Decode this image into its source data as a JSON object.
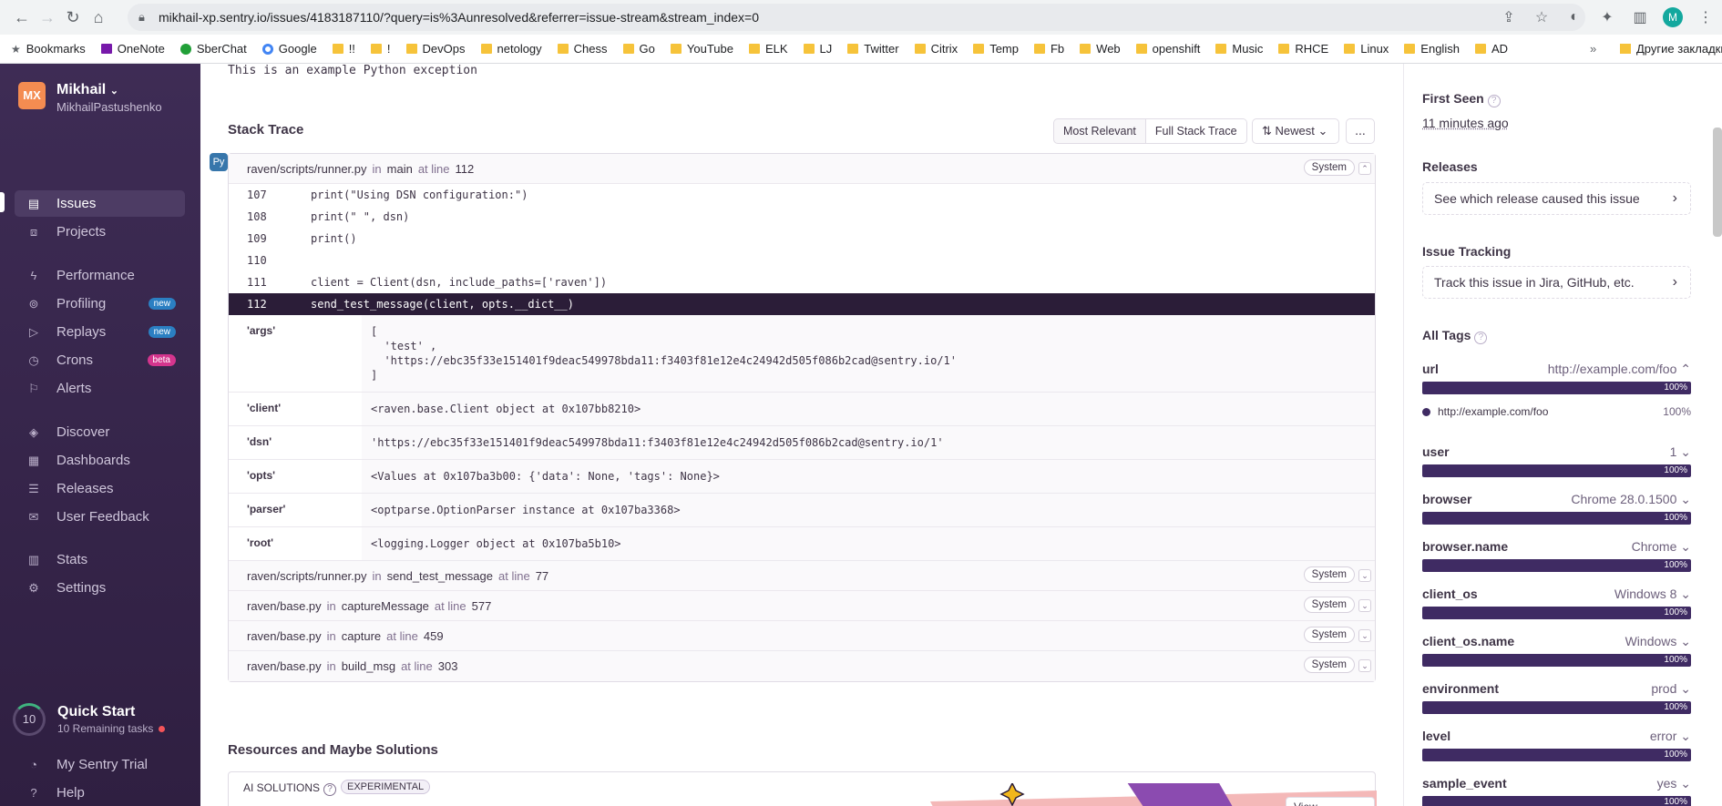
{
  "browser": {
    "url": "mikhail-xp.sentry.io/issues/4183187110/?query=is%3Aunresolved&referrer=issue-stream&stream_index=0",
    "bookmarks": [
      "Bookmarks",
      "OneNote",
      "SberChat",
      "Google",
      "!!",
      "!",
      "DevOps",
      "netology",
      "Chess",
      "Go",
      "YouTube",
      "ELK",
      "LJ",
      "Twitter",
      "Citrix",
      "Temp",
      "Fb",
      "Web",
      "openshift",
      "Music",
      "RHCE",
      "Linux",
      "English",
      "AD"
    ],
    "more": "»",
    "other_bookmarks": "Другие закладки",
    "profile_initial": "M"
  },
  "sidebar": {
    "org_initials": "MX",
    "org_name": "Mikhail",
    "org_user": "MikhailPastushenko",
    "items": [
      {
        "label": "Issues",
        "icon": "issues-icon"
      },
      {
        "label": "Projects",
        "icon": "projects-icon"
      },
      {
        "label": "Performance",
        "icon": "performance-icon"
      },
      {
        "label": "Profiling",
        "icon": "profiling-icon",
        "badge": "new"
      },
      {
        "label": "Replays",
        "icon": "replays-icon",
        "badge": "new"
      },
      {
        "label": "Crons",
        "icon": "crons-icon",
        "badge": "beta"
      },
      {
        "label": "Alerts",
        "icon": "alerts-icon"
      },
      {
        "label": "Discover",
        "icon": "discover-icon"
      },
      {
        "label": "Dashboards",
        "icon": "dashboards-icon"
      },
      {
        "label": "Releases",
        "icon": "releases-icon"
      },
      {
        "label": "User Feedback",
        "icon": "feedback-icon"
      },
      {
        "label": "Stats",
        "icon": "stats-icon"
      },
      {
        "label": "Settings",
        "icon": "settings-icon"
      }
    ],
    "quick_start": {
      "count": "10",
      "title": "Quick Start",
      "subtitle": "10 Remaining tasks"
    },
    "trial": "My Sentry Trial",
    "help": "Help"
  },
  "main": {
    "exception_message": "This is an example Python exception",
    "stack_trace_title": "Stack Trace",
    "view_options": [
      "Most Relevant",
      "Full Stack Trace"
    ],
    "sort": "Newest",
    "more": "...",
    "in_text": "in",
    "at_line_text": "at line",
    "system_label": "System",
    "frame1": {
      "file": "raven/scripts/runner.py",
      "function": "main",
      "line": "112"
    },
    "code_lines": [
      {
        "no": "107",
        "code": "print(\"Using DSN configuration:\")"
      },
      {
        "no": "108",
        "code": "print(\" \", dsn)"
      },
      {
        "no": "109",
        "code": "print()"
      },
      {
        "no": "110",
        "code": ""
      },
      {
        "no": "111",
        "code": "client = Client(dsn, include_paths=['raven'])"
      },
      {
        "no": "112",
        "code": "send_test_message(client, opts.__dict__)"
      }
    ],
    "vars": [
      {
        "key": "'args'",
        "value": "[\n  'test' ,\n  'https://ebc35f33e151401f9deac549978bda11:f3403f81e12e4c24942d505f086b2cad@sentry.io/1'\n]"
      },
      {
        "key": "'client'",
        "value": "<raven.base.Client object at 0x107bb8210>"
      },
      {
        "key": "'dsn'",
        "value": "'https://ebc35f33e151401f9deac549978bda11:f3403f81e12e4c24942d505f086b2cad@sentry.io/1'"
      },
      {
        "key": "'opts'",
        "value": "<Values at 0x107ba3b00: {'data': None, 'tags': None}>"
      },
      {
        "key": "'parser'",
        "value": "<optparse.OptionParser instance at 0x107ba3368>"
      },
      {
        "key": "'root'",
        "value": "<logging.Logger object at 0x107ba5b10>"
      }
    ],
    "other_frames": [
      {
        "file": "raven/scripts/runner.py",
        "function": "send_test_message",
        "line": "77"
      },
      {
        "file": "raven/base.py",
        "function": "captureMessage",
        "line": "577"
      },
      {
        "file": "raven/base.py",
        "function": "capture",
        "line": "459"
      },
      {
        "file": "raven/base.py",
        "function": "build_msg",
        "line": "303"
      }
    ],
    "resources_title": "Resources and Maybe Solutions",
    "ai_label": "AI SOLUTIONS",
    "ai_tag": "EXPERIMENTAL",
    "view_suggestion": "View Suggestion"
  },
  "right": {
    "first_seen_label": "First Seen",
    "first_seen_value": "11 minutes ago",
    "releases_label": "Releases",
    "releases_box": "See which release caused this issue",
    "tracking_label": "Issue Tracking",
    "tracking_box": "Track this issue in Jira, GitHub, etc.",
    "tags_label": "All Tags",
    "tags": [
      {
        "key": "url",
        "value": "http://example.com/foo",
        "pct": "100%"
      },
      {
        "key": "user",
        "value": "1",
        "pct": "100%"
      },
      {
        "key": "browser",
        "value": "Chrome 28.0.1500",
        "pct": "100%"
      },
      {
        "key": "browser.name",
        "value": "Chrome",
        "pct": "100%"
      },
      {
        "key": "client_os",
        "value": "Windows 8",
        "pct": "100%"
      },
      {
        "key": "client_os.name",
        "value": "Windows",
        "pct": "100%"
      },
      {
        "key": "environment",
        "value": "prod",
        "pct": "100%"
      },
      {
        "key": "level",
        "value": "error",
        "pct": "100%"
      },
      {
        "key": "sample_event",
        "value": "yes",
        "pct": "100%"
      }
    ],
    "url_detail": {
      "value": "http://example.com/foo",
      "pct": "100%"
    }
  }
}
